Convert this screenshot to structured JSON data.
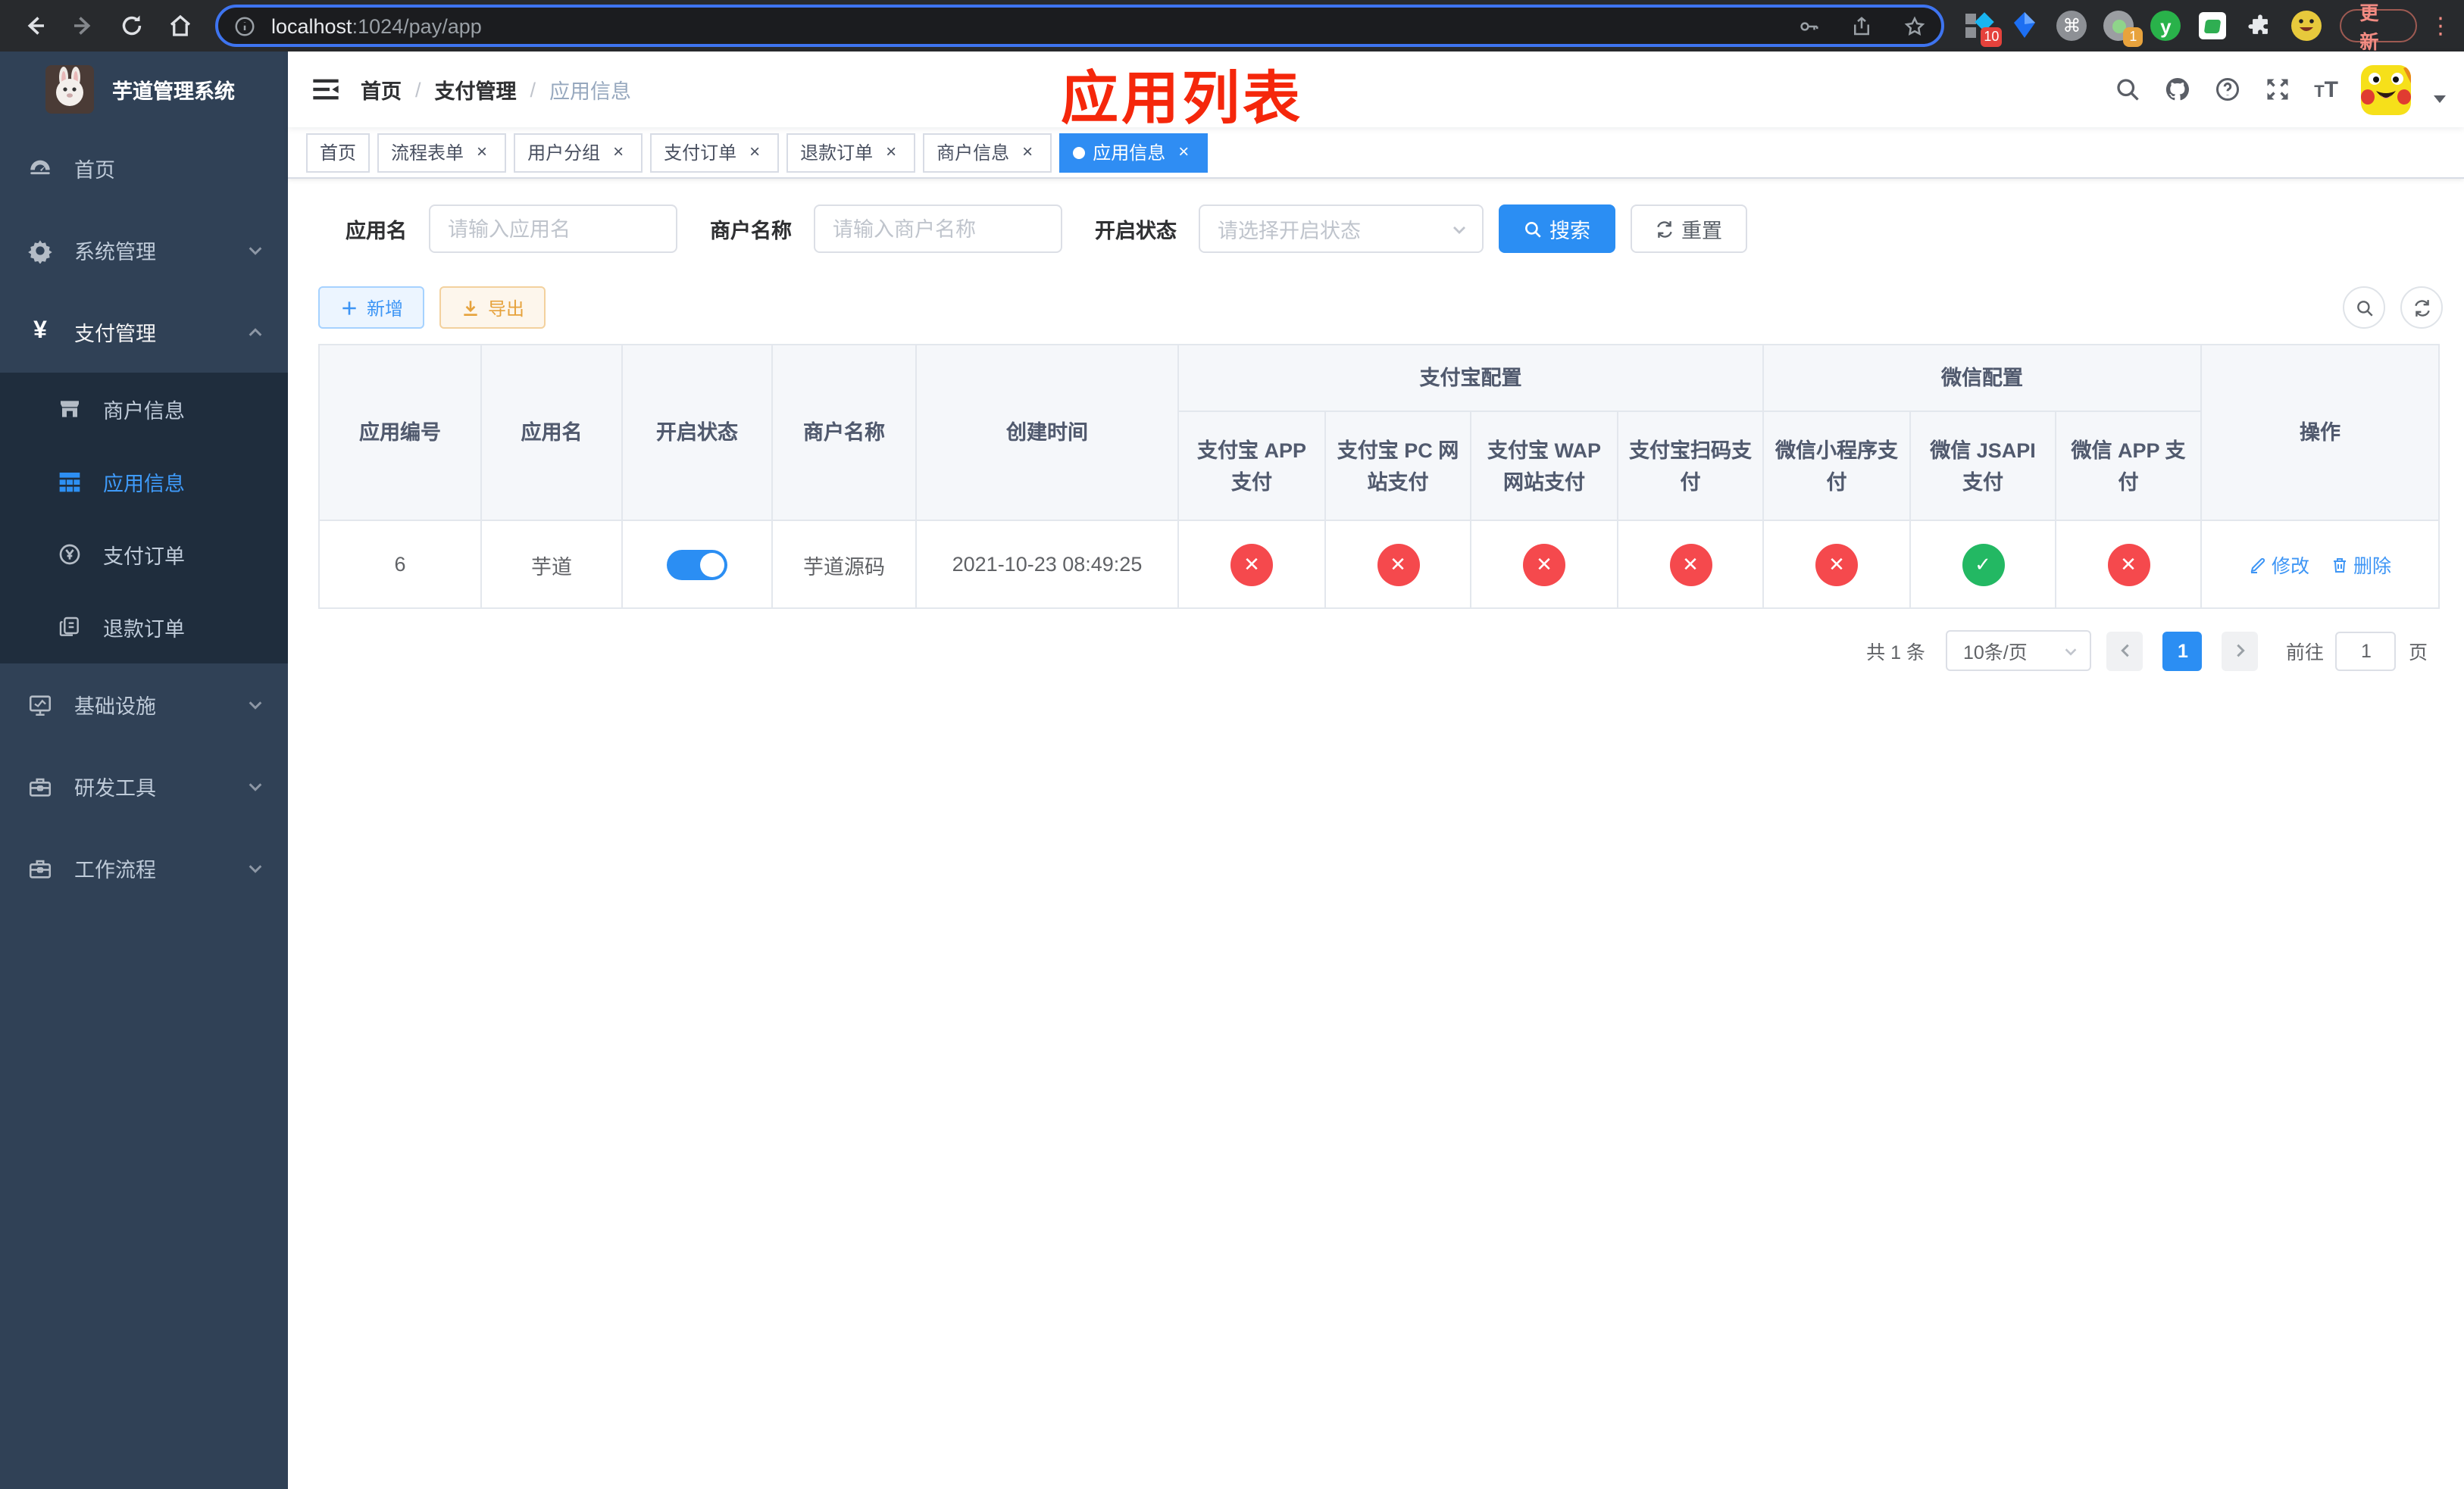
{
  "browser": {
    "url_host": "localhost",
    "url_path": ":1024/pay/app",
    "update_button": "更新",
    "ext_badge_grid": "10",
    "ext_badge_target": "1"
  },
  "sidebar": {
    "title": "芋道管理系统",
    "menu": [
      {
        "label": "首页"
      },
      {
        "label": "系统管理"
      },
      {
        "label": "支付管理"
      },
      {
        "label": "商户信息"
      },
      {
        "label": "应用信息"
      },
      {
        "label": "支付订单"
      },
      {
        "label": "退款订单"
      },
      {
        "label": "基础设施"
      },
      {
        "label": "研发工具"
      },
      {
        "label": "工作流程"
      }
    ]
  },
  "navbar": {
    "breadcrumb": [
      "首页",
      "支付管理",
      "应用信息"
    ],
    "annotation": "应用列表"
  },
  "tabs": [
    {
      "label": "首页"
    },
    {
      "label": "流程表单"
    },
    {
      "label": "用户分组"
    },
    {
      "label": "支付订单"
    },
    {
      "label": "退款订单"
    },
    {
      "label": "商户信息"
    },
    {
      "label": "应用信息"
    }
  ],
  "filters": {
    "app_name": {
      "label": "应用名",
      "placeholder": "请输入应用名"
    },
    "merchant_name": {
      "label": "商户名称",
      "placeholder": "请输入商户名称"
    },
    "status": {
      "label": "开启状态",
      "placeholder": "请选择开启状态"
    },
    "search_button": "搜索",
    "reset_button": "重置"
  },
  "toolbar": {
    "add_button": "新增",
    "export_button": "导出"
  },
  "table": {
    "columns": [
      "应用编号",
      "应用名",
      "开启状态",
      "商户名称",
      "创建时间"
    ],
    "groups": [
      {
        "label": "支付宝配置",
        "children": [
          "支付宝 APP 支付",
          "支付宝 PC 网站支付",
          "支付宝 WAP 网站支付",
          "支付宝扫码支付"
        ]
      },
      {
        "label": "微信配置",
        "children": [
          "微信小程序支付",
          "微信 JSAPI 支付",
          "微信 APP 支付"
        ]
      }
    ],
    "actions_column": "操作",
    "row": {
      "id": "6",
      "name": "芋道",
      "enabled": true,
      "merchant": "芋道源码",
      "created_at": "2021-10-23 08:49:25",
      "statuses": [
        "fail",
        "fail",
        "fail",
        "fail",
        "fail",
        "success",
        "fail"
      ],
      "edit": "修改",
      "delete": "删除"
    }
  },
  "pagination": {
    "total": "共 1 条",
    "page_size": "10条/页",
    "page": "1",
    "goto": "前往",
    "goto_value": "1",
    "unit": "页"
  }
}
